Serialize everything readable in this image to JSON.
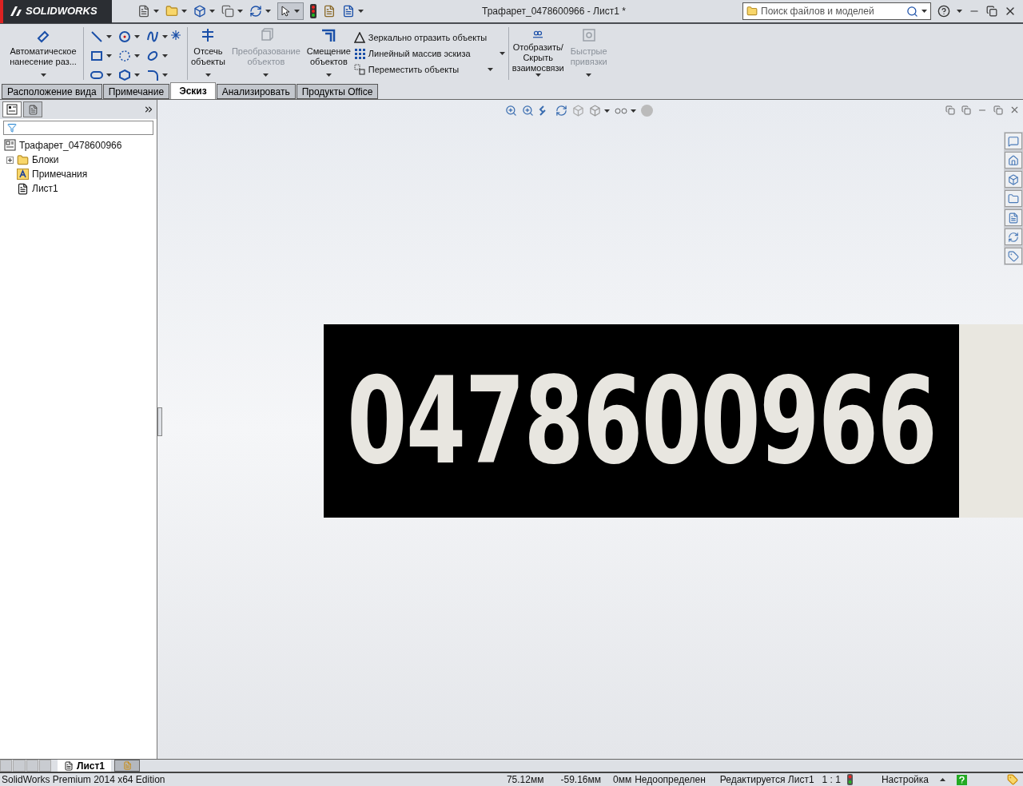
{
  "app": {
    "logo": "SOLIDWORKS"
  },
  "window": {
    "title": "Трафарет_0478600966 - Лист1 *"
  },
  "search": {
    "placeholder": "Поиск файлов и моделей"
  },
  "ribbon": [
    {
      "kind": "large",
      "label": "Автоматическое нанесение раз...",
      "disabled": false
    },
    {
      "kind": "grid"
    },
    {
      "kind": "large",
      "label": "Отсечь объекты",
      "disabled": false
    },
    {
      "kind": "large",
      "label": "Преобразование объектов",
      "disabled": true
    },
    {
      "kind": "large",
      "label": "Смещение объектов",
      "disabled": false
    },
    {
      "kind": "list",
      "items": [
        "Зеркально отразить объекты",
        "Линейный массив эскиза",
        "Переместить объекты"
      ]
    },
    {
      "kind": "large",
      "label": "Отобразить/Скрыть взаимосвязи",
      "disabled": false
    },
    {
      "kind": "large",
      "label": "Быстрые привязки",
      "disabled": true
    }
  ],
  "tabs": [
    {
      "label": "Расположение вида",
      "selected": false
    },
    {
      "label": "Примечание",
      "selected": false
    },
    {
      "label": "Эскиз",
      "selected": true
    },
    {
      "label": "Анализировать",
      "selected": false
    },
    {
      "label": "Продукты Office",
      "selected": false
    }
  ],
  "tree": {
    "label": "Трафарет_0478600966",
    "children": [
      {
        "label": "Блоки",
        "expanded": false,
        "kind": "folder"
      },
      {
        "label": "Примечания",
        "kind": "notes"
      },
      {
        "label": "Лист1",
        "kind": "sheet"
      }
    ]
  },
  "drawing": {
    "number": "0478600966"
  },
  "sheet_tabs": [
    {
      "label": "Лист1",
      "selected": true
    }
  ],
  "status_bar": {
    "product": "SolidWorks Premium 2014 x64 Edition",
    "x": "75.12мм",
    "y": "-59.16мм",
    "z": "0мм",
    "state": "Недоопределен",
    "editing": "Редактируется Лист1",
    "scale": "1 : 1",
    "units": "Настройка"
  }
}
